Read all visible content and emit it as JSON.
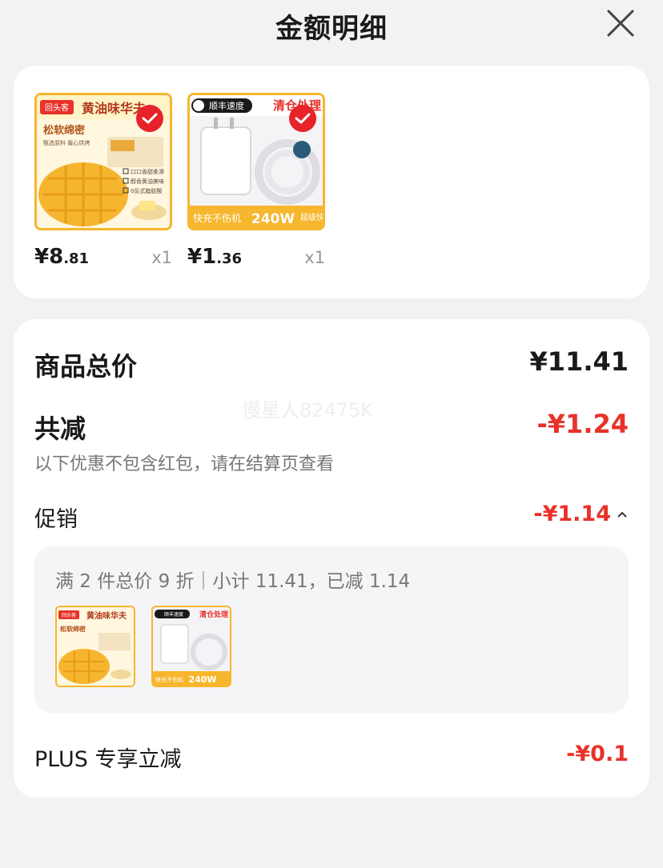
{
  "header": {
    "title": "金额明细",
    "close_icon": "close-icon"
  },
  "products": [
    {
      "price_int": "¥8",
      "price_dec": ".81",
      "qty": "x1",
      "selected": true,
      "thumb": {
        "brand": "回头客",
        "banner": "黄油味华夫",
        "tagline": "松软绵密",
        "desc": "甄选原料 暖心烘烤",
        "features": [
          "口口香甜柔滑",
          "醇香黄油美味",
          "0反式脂肪酸"
        ]
      }
    },
    {
      "price_int": "¥1",
      "price_dec": ".36",
      "qty": "x1",
      "selected": true,
      "thumb": {
        "tag": "顺丰速度",
        "banner": "清仓处理",
        "power": "240W",
        "caption": "快充不伤机",
        "corner": "超级快充"
      }
    }
  ],
  "summary": {
    "total_label": "商品总价",
    "total_value": "¥11.41",
    "discount_label": "共减",
    "discount_value": "-¥1.24",
    "note": "以下优惠不包含红包，请在结算页查看",
    "watermark": "慢星人82475K",
    "promo_label": "促销",
    "promo_value": "-¥1.14",
    "promo_toggle_icon": "chevron-up-icon",
    "promo_detail": "满 2 件总价 9 折｜小计 11.41，已减 1.14",
    "plus_label": "PLUS 专享立减",
    "plus_value": "-¥0.1"
  },
  "colors": {
    "accent_red": "#e8322a",
    "check_red": "#e8222a",
    "thumb_border": "#f6b62d"
  }
}
